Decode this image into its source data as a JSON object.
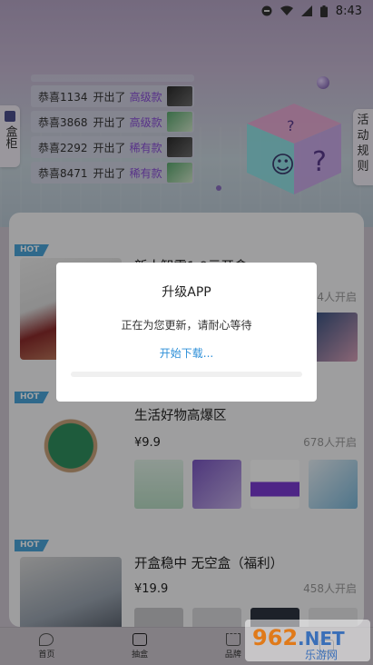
{
  "status_bar": {
    "time": "8:43"
  },
  "hero": {
    "left_tab_label": "盒柜",
    "right_tab_chars": [
      "活",
      "动",
      "规",
      "则"
    ],
    "feed": [
      {
        "user": "恭喜1134",
        "action": "开出了",
        "tier": "高级款",
        "tier_color": "#8a4fd6",
        "thumb": "black"
      },
      {
        "user": "恭喜3868",
        "action": "开出了",
        "tier": "高级款",
        "tier_color": "#8a4fd6",
        "thumb": "green"
      },
      {
        "user": "恭喜2292",
        "action": "开出了",
        "tier": "稀有款",
        "tier_color": "#8a4fd6",
        "thumb": "black"
      },
      {
        "user": "恭喜8471",
        "action": "开出了",
        "tier": "稀有款",
        "tier_color": "#8a4fd6",
        "thumb": "green"
      }
    ]
  },
  "products": [
    {
      "hot": "HOT",
      "title": "新人智需1.9元开盒",
      "price": "",
      "count": "4人开启"
    },
    {
      "hot": "HOT",
      "title": "生活好物高爆区",
      "price": "¥9.9",
      "count": "678人开启"
    },
    {
      "hot": "HOT",
      "title": "开盒稳中 无空盒（福利）",
      "price": "¥19.9",
      "count": "458人开启"
    }
  ],
  "bottom_nav": [
    {
      "label": "首页",
      "icon": "home-icon"
    },
    {
      "label": "抽盒",
      "icon": "box-icon"
    },
    {
      "label": "品牌",
      "icon": "crown-icon"
    },
    {
      "label": "",
      "icon": "cart-icon"
    }
  ],
  "dialog": {
    "title": "升级APP",
    "message": "正在为您更新，请耐心等待",
    "status": "开始下载...",
    "progress": 0.0
  },
  "watermark": {
    "text": "962.NET",
    "sub": "乐游网"
  },
  "colors": {
    "accent": "#2d8fd8",
    "hot": "#4aa4d9",
    "tier": "#8a4fd6"
  }
}
